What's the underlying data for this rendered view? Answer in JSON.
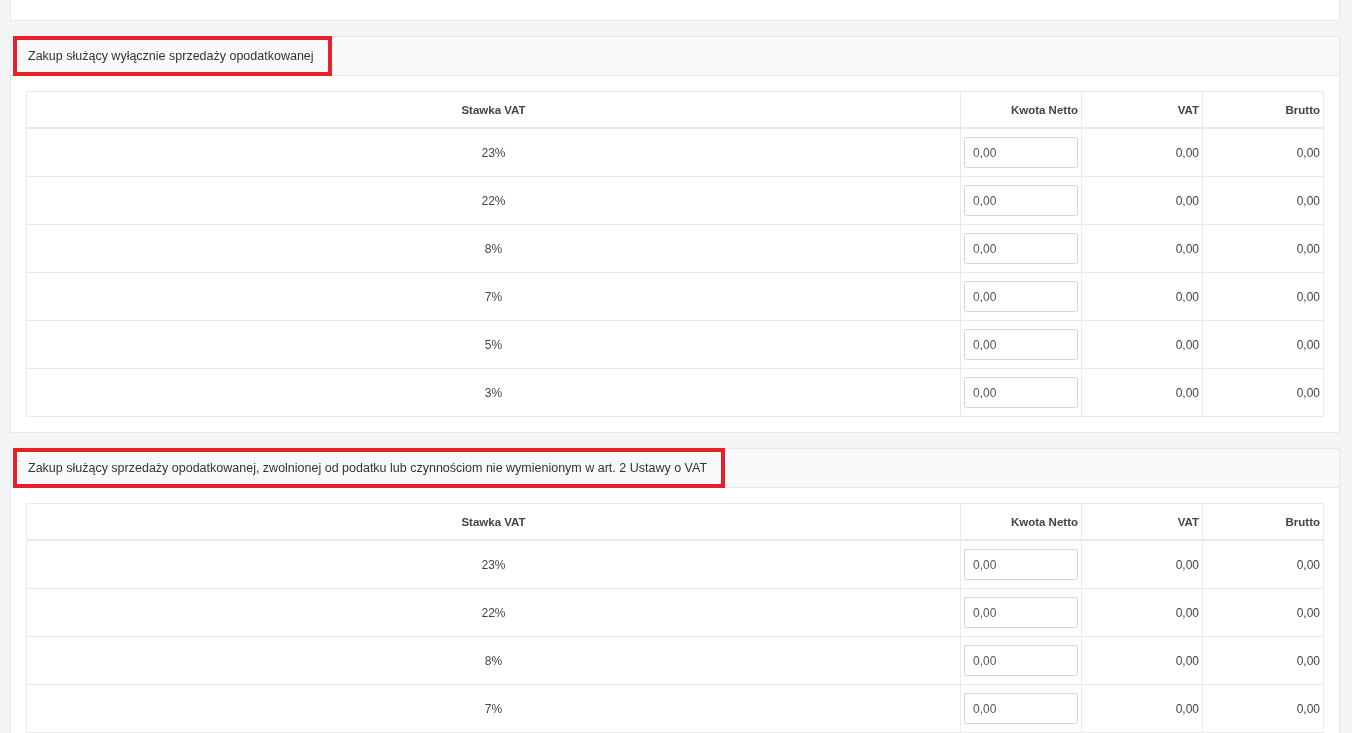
{
  "sections": [
    {
      "title": "Zakup służący wyłącznie sprzedaży opodatkowanej",
      "highlighted": true,
      "columns": [
        "Stawka VAT",
        "Kwota Netto",
        "VAT",
        "Brutto"
      ],
      "rows": [
        {
          "rate": "23%",
          "net": "0,00",
          "vat": "0,00",
          "gross": "0,00"
        },
        {
          "rate": "22%",
          "net": "0,00",
          "vat": "0,00",
          "gross": "0,00"
        },
        {
          "rate": "8%",
          "net": "0,00",
          "vat": "0,00",
          "gross": "0,00"
        },
        {
          "rate": "7%",
          "net": "0,00",
          "vat": "0,00",
          "gross": "0,00"
        },
        {
          "rate": "5%",
          "net": "0,00",
          "vat": "0,00",
          "gross": "0,00"
        },
        {
          "rate": "3%",
          "net": "0,00",
          "vat": "0,00",
          "gross": "0,00"
        }
      ]
    },
    {
      "title": "Zakup służący sprzedaży opodatkowanej, zwolnionej od podatku lub czynnościom nie wymienionym w art. 2 Ustawy o VAT",
      "highlighted": true,
      "columns": [
        "Stawka VAT",
        "Kwota Netto",
        "VAT",
        "Brutto"
      ],
      "rows": [
        {
          "rate": "23%",
          "net": "0,00",
          "vat": "0,00",
          "gross": "0,00"
        },
        {
          "rate": "22%",
          "net": "0,00",
          "vat": "0,00",
          "gross": "0,00"
        },
        {
          "rate": "8%",
          "net": "0,00",
          "vat": "0,00",
          "gross": "0,00"
        },
        {
          "rate": "7%",
          "net": "0,00",
          "vat": "0,00",
          "gross": "0,00"
        }
      ]
    }
  ]
}
